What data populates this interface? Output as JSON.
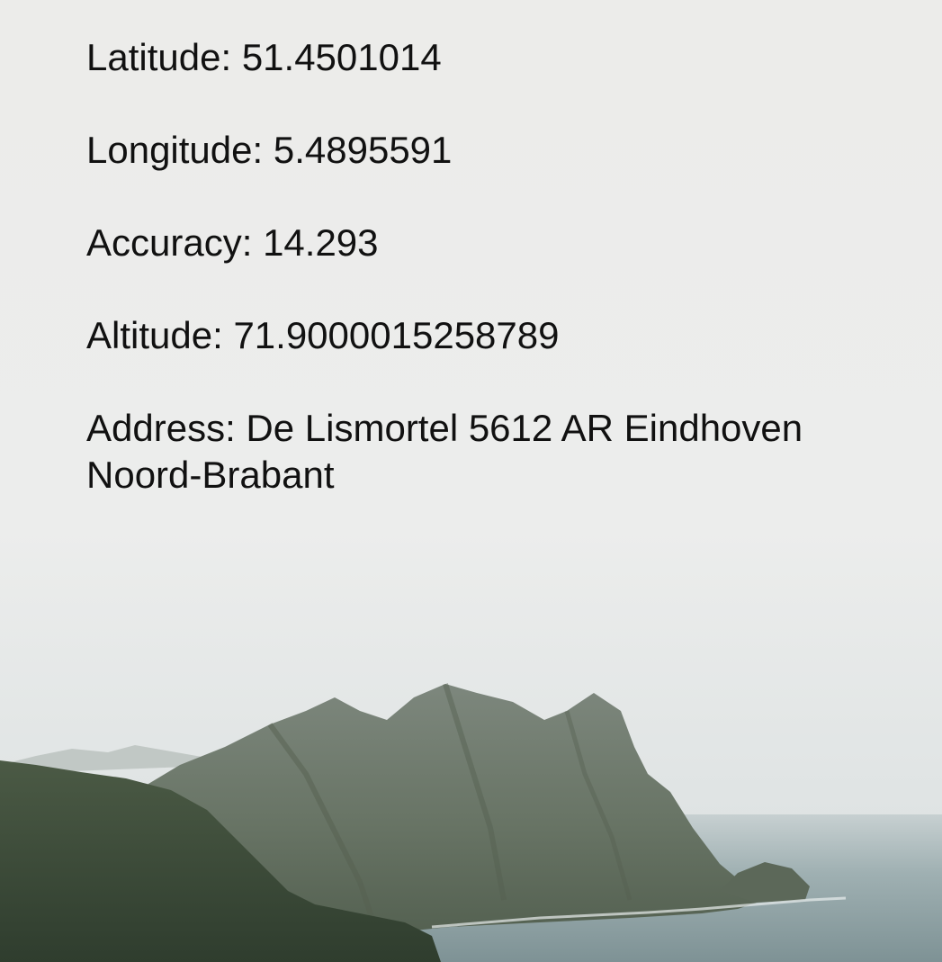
{
  "location": {
    "latitude_label": "Latitude:",
    "latitude_value": "51.4501014",
    "longitude_label": "Longitude:",
    "longitude_value": "5.4895591",
    "accuracy_label": "Accuracy:",
    "accuracy_value": "14.293",
    "altitude_label": "Altitude:",
    "altitude_value": "71.9000015258789",
    "address_label": "Address:",
    "address_line1": "De Lismortel 5612 AR Eindhoven",
    "address_line2": "Noord-Brabant"
  },
  "background": {
    "scene": "misty-coastal-cliff",
    "sky_color": "#ececea",
    "sea_color": "#8fa3a6",
    "cliff_color": "#5e6b5d"
  }
}
